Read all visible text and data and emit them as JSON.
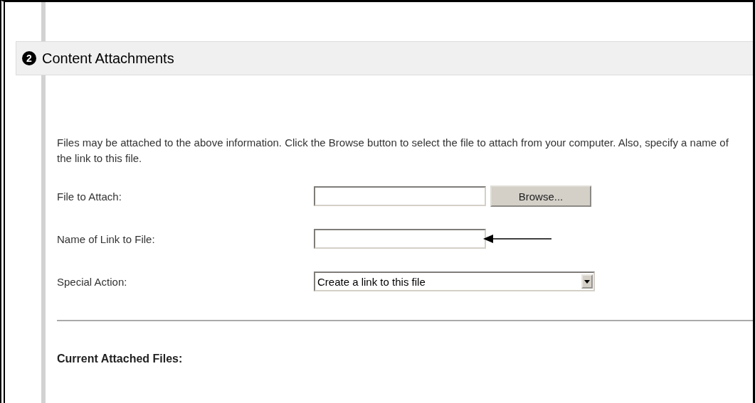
{
  "section": {
    "number": "2",
    "title": "Content Attachments"
  },
  "intro": "Files may be attached to the above information. Click the Browse button to select the file to attach from your computer. Also, specify a name of the link to this file.",
  "fields": [
    {
      "kind": "file",
      "label": "File to Attach:",
      "button": "Browse..."
    },
    {
      "kind": "text",
      "label": "Name of Link to File:",
      "pointer": true
    },
    {
      "kind": "select",
      "label": "Special Action:",
      "value": "Create a link to this file"
    }
  ],
  "attached_heading": "Current Attached Files:"
}
